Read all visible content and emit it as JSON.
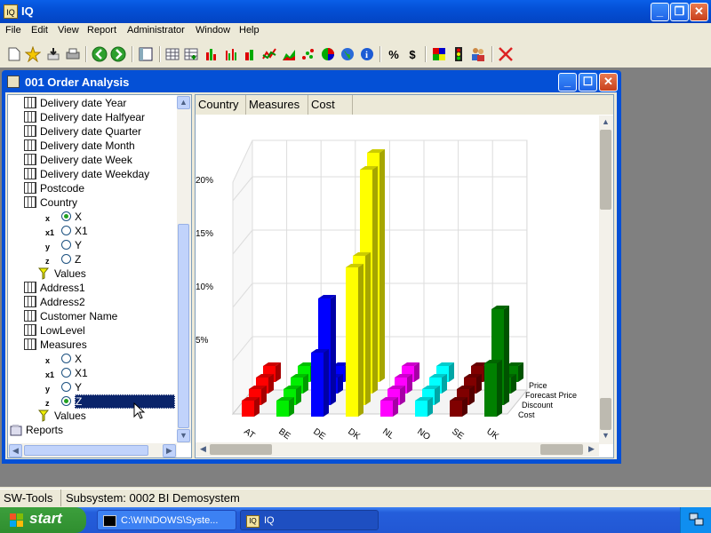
{
  "app": {
    "title": "IQ",
    "icon_text": "IQ"
  },
  "menu": [
    "File",
    "Edit",
    "View",
    "Report",
    "Administrator",
    "Window",
    "Help"
  ],
  "toolbar_icons": [
    "new-icon",
    "favorite-icon",
    "download-icon",
    "print-icon",
    "back-icon",
    "forward-icon",
    "layout-icon",
    "table-icon",
    "table-add-icon",
    "bar-chart-icon",
    "bar-chart-icon-2",
    "bar-chart-icon-3",
    "line-chart-icon",
    "area-chart-icon",
    "scatter-icon",
    "pie-chart-icon",
    "globe-icon",
    "info-icon",
    "percent-icon",
    "currency-icon",
    "colors-icon",
    "traffic-light-icon",
    "users-icon",
    "delete-icon"
  ],
  "child_window": {
    "title": "001  Order Analysis"
  },
  "tree": {
    "nodes": [
      {
        "label": "Delivery date Year",
        "type": "dim"
      },
      {
        "label": "Delivery date Halfyear",
        "type": "dim"
      },
      {
        "label": "Delivery date Quarter",
        "type": "dim"
      },
      {
        "label": "Delivery date Month",
        "type": "dim"
      },
      {
        "label": "Delivery date Week",
        "type": "dim"
      },
      {
        "label": "Delivery date Weekday",
        "type": "dim"
      },
      {
        "label": "Postcode",
        "type": "dim"
      },
      {
        "label": "Country",
        "type": "dim"
      },
      {
        "label": "X",
        "type": "axis",
        "on": true
      },
      {
        "label": "X1",
        "type": "axis",
        "on": false
      },
      {
        "label": "Y",
        "type": "axis",
        "on": false
      },
      {
        "label": "Z",
        "type": "axis",
        "on": false
      },
      {
        "label": "Values",
        "type": "filter"
      },
      {
        "label": "Address1",
        "type": "dim"
      },
      {
        "label": "Address2",
        "type": "dim"
      },
      {
        "label": "Customer Name",
        "type": "dim"
      },
      {
        "label": "LowLevel",
        "type": "dim"
      },
      {
        "label": "Measures",
        "type": "dim"
      },
      {
        "label": "X",
        "type": "axis",
        "on": false
      },
      {
        "label": "X1",
        "type": "axis",
        "on": false
      },
      {
        "label": "Y",
        "type": "axis",
        "on": false
      },
      {
        "label": "Z",
        "type": "axis",
        "on": true,
        "selected": true
      },
      {
        "label": "Values",
        "type": "filter"
      },
      {
        "label": "Reports",
        "type": "reports"
      }
    ]
  },
  "chart_header": [
    "Country",
    "Measures",
    "Cost"
  ],
  "chart_data": {
    "type": "bar",
    "categories": [
      "AT",
      "BE",
      "DE",
      "DK",
      "NL",
      "NO",
      "SE",
      "UK"
    ],
    "series": [
      {
        "name": "Cost",
        "values": [
          1.5,
          1.5,
          6.0,
          14.0,
          1.5,
          1.5,
          1.5,
          5.0
        ],
        "color": "#ff0000"
      },
      {
        "name": "Discount",
        "values": [
          1.5,
          1.5,
          10.0,
          14.0,
          1.5,
          1.5,
          1.5,
          9.0
        ],
        "color": "#00cc00"
      },
      {
        "name": "Forecast Price",
        "values": [
          1.5,
          1.5,
          1.5,
          21.0,
          1.5,
          1.5,
          1.5,
          1.5
        ],
        "color": "#0000ff"
      },
      {
        "name": "Price",
        "values": [
          1.5,
          1.5,
          1.5,
          21.5,
          1.5,
          1.5,
          1.5,
          1.5
        ],
        "color": "#ffff00"
      }
    ],
    "category_colors": [
      "#ff0000",
      "#00ee00",
      "#0000ff",
      "#ffff00",
      "#ff00ff",
      "#00ffff",
      "#800000",
      "#008000"
    ],
    "y_ticks": [
      "5%",
      "10%",
      "15%",
      "20%"
    ],
    "legend": [
      "Price",
      "Forecast Price",
      "Discount",
      "Cost"
    ],
    "ylim": [
      0,
      25
    ]
  },
  "status": {
    "left": "SW-Tools",
    "right": "Subsystem: 0002 BI Demosystem"
  },
  "taskbar": {
    "start": "start",
    "tasks": [
      "C:\\WINDOWS\\Syste...",
      "IQ"
    ]
  }
}
